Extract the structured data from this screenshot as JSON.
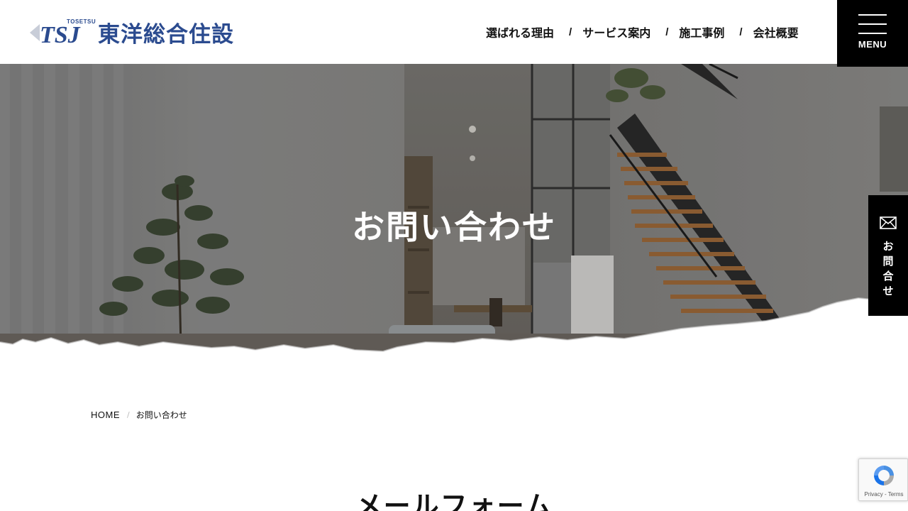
{
  "header": {
    "logo_mark_text": "TSJ",
    "logo_sub": "TOSETSU",
    "logo_name": "東洋総合住設",
    "nav": [
      {
        "label": "選ばれる理由"
      },
      {
        "label": "サービス案内"
      },
      {
        "label": "施工事例"
      },
      {
        "label": "会社概要"
      }
    ],
    "nav_separator": "/",
    "menu_label": "MENU"
  },
  "hero": {
    "title": "お問い合わせ"
  },
  "side_contact": {
    "label_chars": [
      "お",
      "問",
      "合",
      "せ"
    ],
    "icon": "mail-icon"
  },
  "breadcrumb": {
    "home": "HOME",
    "separator": "/",
    "current": "お問い合わせ"
  },
  "main": {
    "section_title": "メールフォーム"
  },
  "recaptcha": {
    "links": "Privacy - Terms"
  },
  "colors": {
    "brand_blue": "#2b4b8f",
    "black": "#000000",
    "white": "#ffffff"
  }
}
